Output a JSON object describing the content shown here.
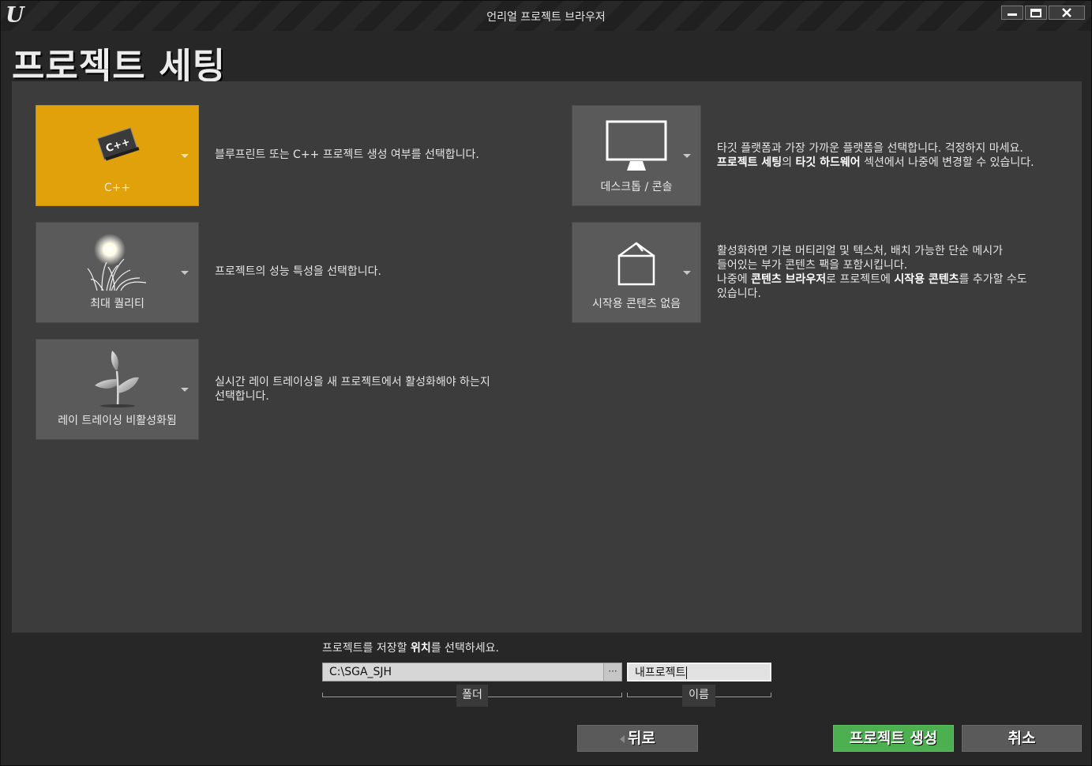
{
  "window": {
    "title": "언리얼 프로젝트 브라우저",
    "logo": "U",
    "controls": [
      "minimize-icon",
      "maximize-icon",
      "close-icon"
    ]
  },
  "page_title": "프로젝트 세팅",
  "settings": [
    {
      "id": "project-type",
      "label": "C++",
      "icon": "cpp-icon",
      "selected": true,
      "description_html": "블루프린트 또는 C++ 프로젝트 생성 여부를 선택합니다."
    },
    {
      "id": "quality",
      "label": "최대 퀄리티",
      "icon": "max-quality-icon",
      "selected": false,
      "description_html": "프로젝트의 성능 특성을 선택합니다."
    },
    {
      "id": "raytracing",
      "label": "레이 트레이싱 비활성화됨",
      "icon": "raytracing-off-icon",
      "selected": false,
      "description_line1": "실시간 레이 트레이싱을 새 프로젝트에서 활성화해야 하는지",
      "description_line2": "선택합니다."
    },
    {
      "id": "platform",
      "label": "데스크톱 / 콘솔",
      "icon": "desktop-monitor-icon",
      "selected": false,
      "description_line1": "타깃 플랫폼과 가장 가까운 플랫폼을 선택합니다. 걱정하지 마세요.",
      "description_line2_parts": [
        "프로젝트 세팅",
        "의 ",
        "타깃 하드웨어",
        " 섹션에서 나중에 변경할 수 있습니다."
      ]
    },
    {
      "id": "starter-content",
      "label": "시작용 콘텐츠 없음",
      "icon": "empty-box-icon",
      "selected": false,
      "description_line1": "활성화하면 기본 머티리얼 및 텍스처, 배치 가능한 단순 메시가",
      "description_line2": "들어있는 부가 콘텐츠 팩을 포함시킵니다.",
      "description_line3_parts": [
        "나중에 ",
        "콘텐츠 브라우저",
        "로 프로젝트에 ",
        "시작용 콘텐츠",
        "를 추가할 수도"
      ],
      "description_line4": "있습니다."
    }
  ],
  "location": {
    "hint_parts": [
      "프로젝트를 저장할 ",
      "위치",
      "를 선택하세요."
    ],
    "folder_value": "C:\\SGA_SJH",
    "browse_label": "···",
    "folder_caption": "폴더",
    "name_value": "내프로젝트",
    "name_caption": "이름"
  },
  "buttons": {
    "back": "뒤로",
    "create": "프로젝트 생성",
    "cancel": "취소"
  },
  "colors": {
    "selected_tile": "#e0a10a",
    "create_button": "#4caf50"
  }
}
